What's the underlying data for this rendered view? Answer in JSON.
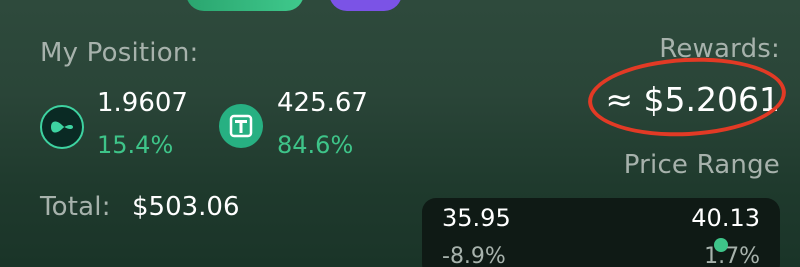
{
  "position": {
    "label": "My Position:",
    "tokens": [
      {
        "icon": "token-a-icon",
        "amount": "1.9607",
        "percent": "15.4%"
      },
      {
        "icon": "tether-icon",
        "amount": "425.67",
        "percent": "84.6%"
      }
    ],
    "total_label": "Total:",
    "total_value": "$503.06"
  },
  "rewards": {
    "label": "Rewards:",
    "value": "≈ $5.2061"
  },
  "price_range": {
    "label": "Price Range",
    "min": "35.95",
    "min_change": "-8.9%",
    "max": "40.13",
    "max_change": "1.7%"
  },
  "colors": {
    "accent_green": "#3ec489",
    "annotation_red": "#e23a25",
    "purple": "#7b53e6"
  }
}
